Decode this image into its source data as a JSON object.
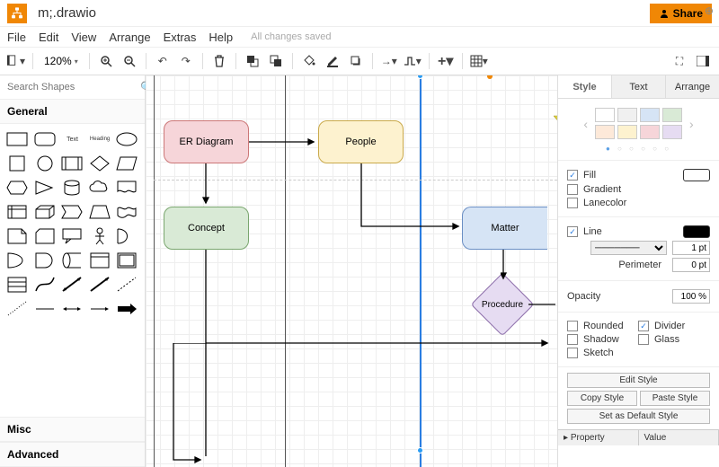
{
  "app": {
    "title": "m;.drawio",
    "share_label": "Share",
    "saved_status": "All changes saved"
  },
  "menu": {
    "file": "File",
    "edit": "Edit",
    "view": "View",
    "arrange": "Arrange",
    "extras": "Extras",
    "help": "Help"
  },
  "toolbar": {
    "zoom": "120%"
  },
  "left": {
    "search_placeholder": "Search Shapes",
    "general": "General",
    "misc": "Misc",
    "advanced": "Advanced",
    "text_label": "Text",
    "heading_label": "Heading"
  },
  "nodes": {
    "er": "ER Diagram",
    "people": "People",
    "concept": "Concept",
    "matter": "Matter",
    "procedure": "Procedure"
  },
  "panel": {
    "tab_style": "Style",
    "tab_text": "Text",
    "tab_arrange": "Arrange",
    "fill": "Fill",
    "gradient": "Gradient",
    "lanecolor": "Lanecolor",
    "line": "Line",
    "line_width": "1 pt",
    "perimeter": "Perimeter",
    "perimeter_val": "0 pt",
    "opacity": "Opacity",
    "opacity_val": "100 %",
    "rounded": "Rounded",
    "divider": "Divider",
    "shadow": "Shadow",
    "glass": "Glass",
    "sketch": "Sketch",
    "edit_style": "Edit Style",
    "copy_style": "Copy Style",
    "paste_style": "Paste Style",
    "set_default": "Set as Default Style",
    "property": "Property",
    "value": "Value"
  },
  "swatches": {
    "row1": [
      "#ffffff",
      "#f0f0f0",
      "#d6e4f5",
      "#d9ead6"
    ],
    "row2": [
      "#fde9d9",
      "#fdf2cf",
      "#f6d5d9",
      "#e6dcf2"
    ]
  },
  "chart_data": {
    "type": "diagram",
    "tool": "drawio",
    "nodes": [
      {
        "id": "er",
        "label": "ER Diagram",
        "shape": "rounded-rect",
        "fill": "#f6d5d9",
        "lane": 0
      },
      {
        "id": "people",
        "label": "People",
        "shape": "rounded-rect",
        "fill": "#fdf2cf",
        "lane": 1
      },
      {
        "id": "concept",
        "label": "Concept",
        "shape": "rounded-rect",
        "fill": "#d9ead6",
        "lane": 0
      },
      {
        "id": "matter",
        "label": "Matter",
        "shape": "rounded-rect",
        "fill": "#d6e4f5",
        "lane": 2
      },
      {
        "id": "procedure",
        "label": "Procedure",
        "shape": "diamond",
        "fill": "#e6dcf2",
        "lane": 2
      }
    ],
    "edges": [
      {
        "from": "er",
        "to": "people"
      },
      {
        "from": "er",
        "to": "concept"
      },
      {
        "from": "people",
        "to": "matter"
      },
      {
        "from": "matter",
        "to": "procedure"
      },
      {
        "from": "concept",
        "to": "below"
      },
      {
        "from": "procedure",
        "to": "right"
      }
    ],
    "swimlanes": 3,
    "selected_lane": 2
  }
}
